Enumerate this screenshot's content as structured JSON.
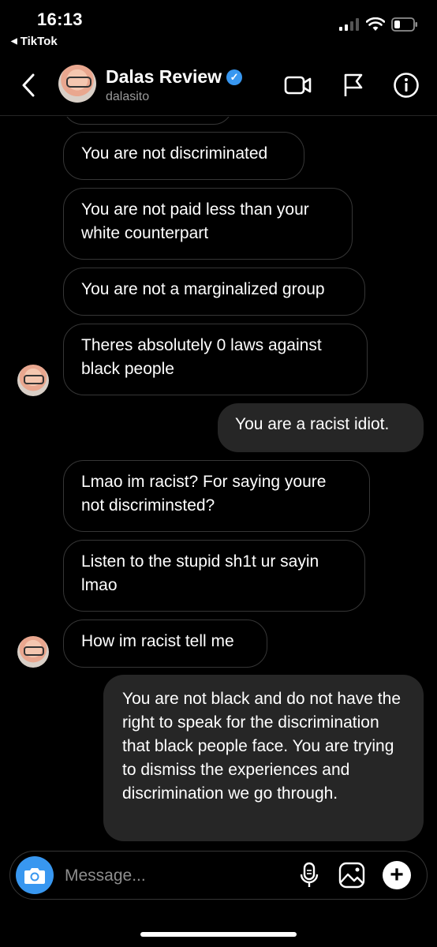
{
  "status_bar": {
    "time": "16:13",
    "back_app": "TikTok"
  },
  "header": {
    "name": "Dalas Review",
    "handle": "dalasito",
    "verified_icon": "verified-badge-icon"
  },
  "messages": [
    {
      "from": "them",
      "text": "You are not discriminated"
    },
    {
      "from": "them",
      "text": "You are not paid less than your white counterpart"
    },
    {
      "from": "them",
      "text": "You are not a marginalized group"
    },
    {
      "from": "them",
      "text": "Theres absolutely 0 laws against black people"
    },
    {
      "from": "me",
      "text": "You are a racist idiot."
    },
    {
      "from": "them",
      "text": "Lmao im racist? For saying youre not discriminsted?"
    },
    {
      "from": "them",
      "text": "Listen to the stupid sh1t ur sayin lmao"
    },
    {
      "from": "them",
      "text": "How im racist tell me"
    },
    {
      "from": "me",
      "text": "You are not black and do not have the right to speak for the discrimination that black people face. You are trying to dismiss the experiences and discrimination we go through."
    }
  ],
  "composer": {
    "placeholder": "Message..."
  },
  "colors": {
    "accent": "#3897f0",
    "sent_bubble": "#262626",
    "received_border": "#363636"
  }
}
